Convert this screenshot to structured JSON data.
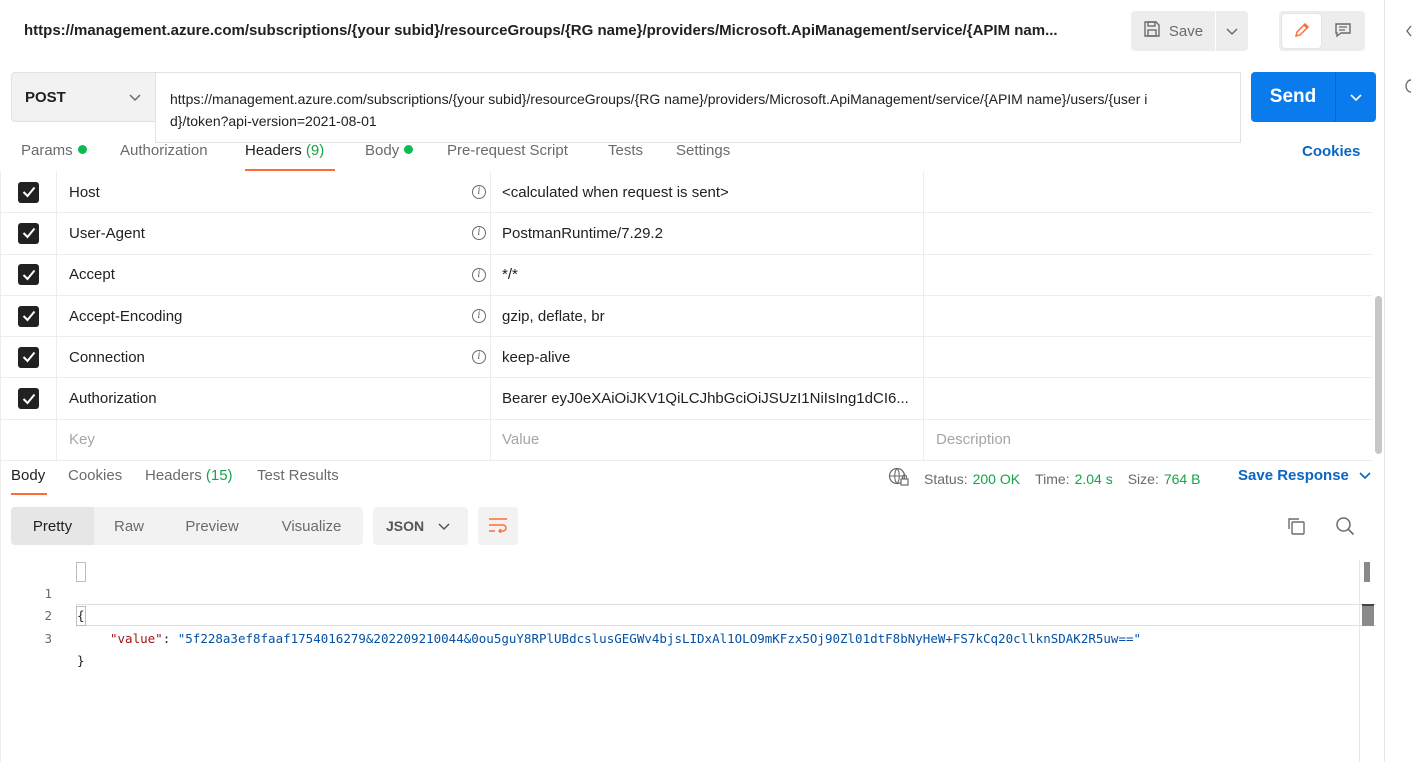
{
  "title_bar": {
    "url": "https://management.azure.com/subscriptions/{your subid}/resourceGroups/{RG name}/providers/Microsoft.ApiManagement/service/{APIM nam...",
    "save_label": "Save"
  },
  "request": {
    "method": "POST",
    "url": "https://management.azure.com/subscriptions/{your subid}/resourceGroups/{RG name}/providers/Microsoft.ApiManagement/service/{APIM name}/users/{user id}/token?api-version=2021-08-01",
    "send_label": "Send"
  },
  "tabs": {
    "params": "Params",
    "authorization": "Authorization",
    "headers": "Headers",
    "headers_count": "(9)",
    "body": "Body",
    "prerequest": "Pre-request Script",
    "tests": "Tests",
    "settings": "Settings",
    "cookies": "Cookies"
  },
  "headers": [
    {
      "key": "Host",
      "value": "<calculated when request is sent>",
      "info": true
    },
    {
      "key": "User-Agent",
      "value": "PostmanRuntime/7.29.2",
      "info": true
    },
    {
      "key": "Accept",
      "value": "*/*",
      "info": true
    },
    {
      "key": "Accept-Encoding",
      "value": "gzip, deflate, br",
      "info": true
    },
    {
      "key": "Connection",
      "value": "keep-alive",
      "info": true
    },
    {
      "key": "Authorization",
      "value": "Bearer eyJ0eXAiOiJKV1QiLCJhbGciOiJSUzI1NiIsIng1dCI6...",
      "info": false
    }
  ],
  "headers_placeholder": {
    "key": "Key",
    "value": "Value",
    "description": "Description"
  },
  "response": {
    "tabs": {
      "body": "Body",
      "cookies": "Cookies",
      "headers": "Headers",
      "headers_count": "(15)",
      "test_results": "Test Results"
    },
    "status_label": "Status:",
    "status_value": "200 OK",
    "time_label": "Time:",
    "time_value": "2.04 s",
    "size_label": "Size:",
    "size_value": "764 B",
    "save_response": "Save Response",
    "views": [
      "Pretty",
      "Raw",
      "Preview",
      "Visualize"
    ],
    "format": "JSON",
    "body_lines": {
      "n1": "1",
      "n2": "2",
      "n3": "3",
      "open_brace": "{",
      "key": "\"value\"",
      "colon": ": ",
      "value": "\"5f228a3ef8faaf1754016279&202209210044&0ou5guY8RPlUBdcslusGEGWv4bjsLIDxAl1OLO9mKFzx5Oj90Zl01dtF8bNyHeW+FS7kCq20cllknSDAK2R5uw==\"",
      "close_brace": "}"
    }
  },
  "colors": {
    "accent": "#ff6c37",
    "send": "#097bed",
    "link": "#0a66c2",
    "status_green": "#16a34a",
    "dot_green": "#0cbb52"
  },
  "icons": [
    "save-icon",
    "chevron-down-icon",
    "pencil-icon",
    "comment-icon",
    "info-icon",
    "checkbox-checked-icon",
    "globe-lock-icon",
    "wrap-lines-icon",
    "copy-icon",
    "search-icon"
  ]
}
